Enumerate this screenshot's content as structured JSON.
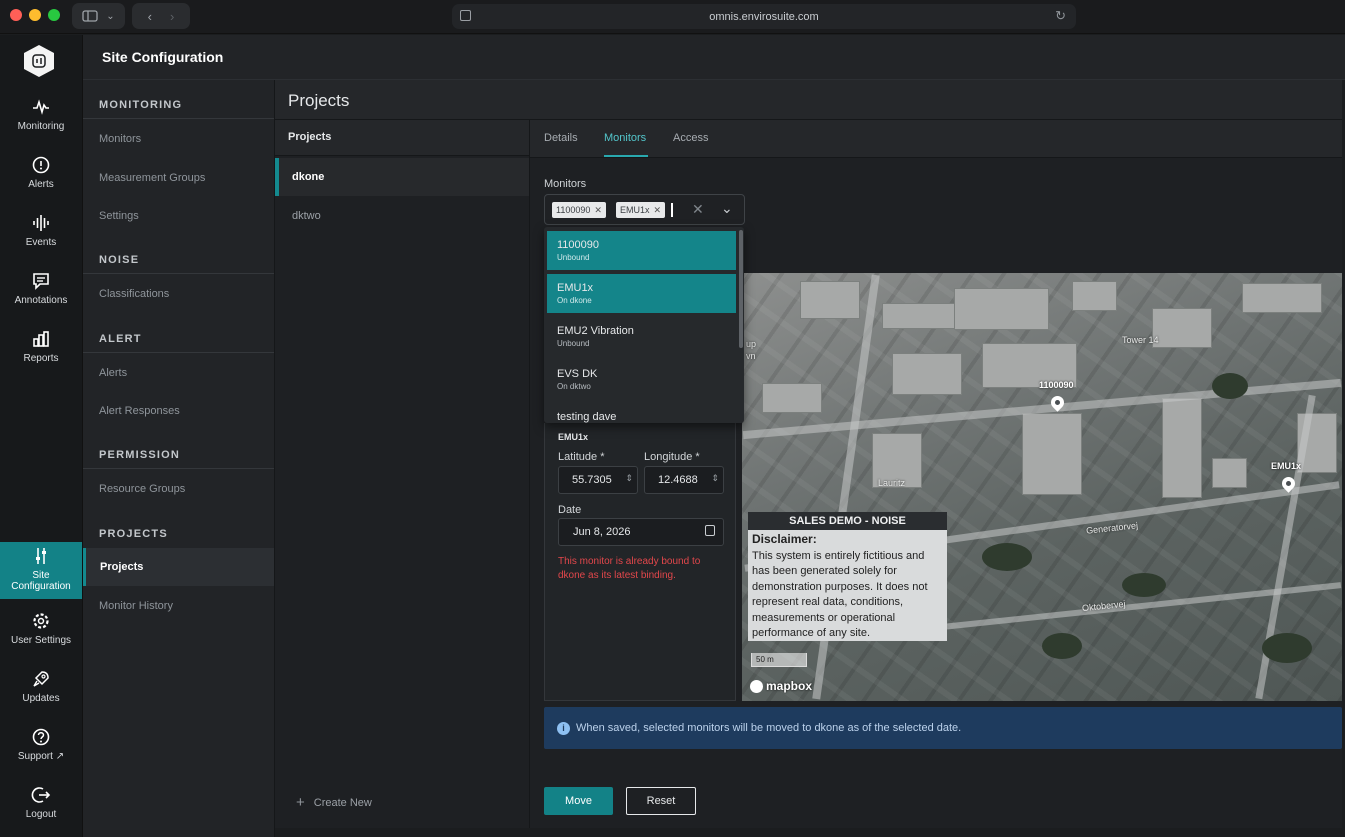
{
  "browser": {
    "url": "omnis.envirosuite.com"
  },
  "rail": {
    "items": [
      {
        "label": "Monitoring",
        "icon": "pulse-icon"
      },
      {
        "label": "Alerts",
        "icon": "alert-icon"
      },
      {
        "label": "Events",
        "icon": "waveform-icon"
      },
      {
        "label": "Annotations",
        "icon": "comment-icon"
      },
      {
        "label": "Reports",
        "icon": "bar-chart-icon"
      },
      {
        "label": "Site Configuration",
        "label_l1": "Site",
        "label_l2": "Configuration",
        "icon": "sliders-icon",
        "active": true
      },
      {
        "label": "User Settings",
        "icon": "gear-icon"
      },
      {
        "label": "Updates",
        "icon": "rocket-icon"
      },
      {
        "label": "Support",
        "icon": "help-icon"
      },
      {
        "label": "Logout",
        "icon": "logout-icon"
      }
    ]
  },
  "sidebar": {
    "title": "Site Configuration",
    "sections": [
      {
        "title": "MONITORING",
        "items": [
          "Monitors",
          "Measurement Groups",
          "Settings"
        ]
      },
      {
        "title": "NOISE",
        "items": [
          "Classifications"
        ]
      },
      {
        "title": "ALERT",
        "items": [
          "Alerts",
          "Alert Responses"
        ]
      },
      {
        "title": "PERMISSION",
        "items": [
          "Resource Groups"
        ]
      },
      {
        "title": "PROJECTS",
        "items": [
          "Projects",
          "Monitor History"
        ],
        "active": "Projects"
      }
    ]
  },
  "main": {
    "title": "Projects",
    "project_list": {
      "header": "Projects",
      "items": [
        "dkone",
        "dktwo"
      ],
      "selected": "dkone",
      "create_new": "Create New"
    },
    "tabs": [
      "Details",
      "Monitors",
      "Access"
    ],
    "active_tab": "Monitors",
    "monitors": {
      "label": "Monitors",
      "chips": [
        "1100090",
        "EMU1x"
      ],
      "options": [
        {
          "name": "1100090",
          "status": "Unbound",
          "selected": true
        },
        {
          "name": "EMU1x",
          "status": "On dkone",
          "selected": true
        },
        {
          "name": "EMU2 Vibration",
          "status": "Unbound",
          "selected": false
        },
        {
          "name": "EVS DK",
          "status": "On dktwo",
          "selected": false
        },
        {
          "name": "testing dave",
          "status": "",
          "selected": false
        }
      ]
    },
    "editor": {
      "monitor_name": "EMU1x",
      "latitude_label": "Latitude *",
      "latitude_value": "55.7305",
      "longitude_label": "Longitude *",
      "longitude_value": "12.4688",
      "date_label": "Date",
      "date_value": "Jun 8, 2026",
      "error": "This monitor is already bound to dkone as its latest binding."
    },
    "map": {
      "pins": [
        "1100090",
        "EMU1x"
      ],
      "labels": [
        "Tower 14",
        "Lauritz",
        "Generatorvej",
        "Oktobervej",
        "up",
        "vn"
      ],
      "disclaimer_title": "SALES DEMO - NOISE",
      "disclaimer_heading": "Disclaimer:",
      "disclaimer_text": "This system is entirely fictitious and has been generated solely for demonstration purposes. It does not represent real data, conditions, measurements or operational performance of any site.",
      "scale": "50 m",
      "attribution": "mapbox"
    },
    "info_text": "When saved, selected monitors will be moved to dkone as of the selected date.",
    "buttons": {
      "move": "Move",
      "reset": "Reset"
    }
  },
  "colors": {
    "accent": "#138287",
    "accent_light": "#53c6cb",
    "error": "#e2474b",
    "info_bg": "#1e3b5e"
  }
}
